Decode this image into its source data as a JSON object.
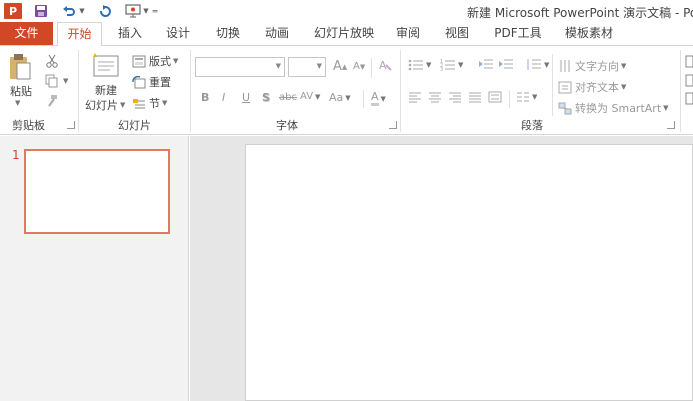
{
  "titlebar": {
    "app_logo": "P",
    "window_title": "新建 Microsoft PowerPoint 演示文稿 - Pow",
    "icons": [
      "powerpoint-logo-icon",
      "save-icon",
      "undo-icon",
      "redo-icon",
      "slideshow-icon"
    ]
  },
  "tabs": [
    {
      "label": "文件"
    },
    {
      "label": "开始"
    },
    {
      "label": "插入"
    },
    {
      "label": "设计"
    },
    {
      "label": "切换"
    },
    {
      "label": "动画"
    },
    {
      "label": "幻灯片放映"
    },
    {
      "label": "审阅"
    },
    {
      "label": "视图"
    },
    {
      "label": "PDF工具"
    },
    {
      "label": "模板素材"
    }
  ],
  "ribbon": {
    "clipboard": {
      "label": "剪贴板",
      "paste": "粘贴",
      "icons": [
        "paste-icon",
        "cut-icon",
        "copy-icon",
        "format-painter-icon"
      ]
    },
    "slides": {
      "label": "幻灯片",
      "new_slide_line1": "新建",
      "new_slide_line2": "幻灯片",
      "layout": "版式",
      "reset": "重置",
      "section": "节"
    },
    "font": {
      "label": "字体",
      "font_name_value": "",
      "font_size_value": "",
      "grow": "A",
      "shrink": "A",
      "bold": "B",
      "italic": "I",
      "underline": "U",
      "shadow": "S",
      "strike": "abc",
      "spacing": "AV",
      "case": "Aa",
      "color": "A"
    },
    "paragraph": {
      "label": "段落",
      "text_direction": "文字方向",
      "align_text": "对齐文本",
      "smartart": "转换为 SmartArt"
    }
  },
  "slides_panel": {
    "slide_number": "1"
  },
  "colors": {
    "accent": "#d24726",
    "thumb_border": "#e07a5f"
  }
}
